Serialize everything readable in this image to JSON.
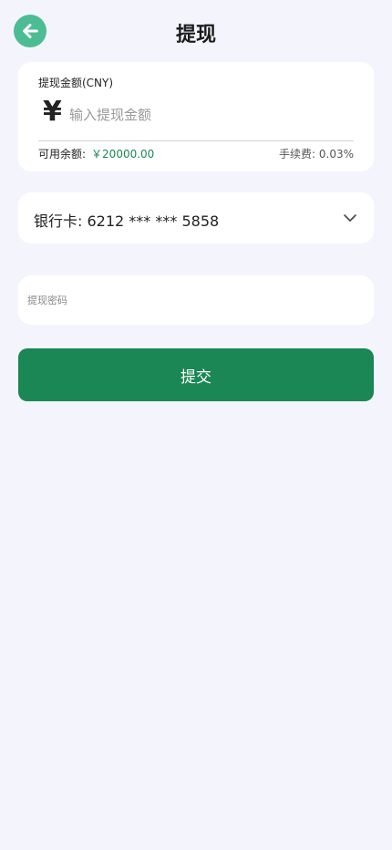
{
  "header": {
    "title": "提现",
    "back_icon": "arrow-left-icon"
  },
  "amount": {
    "label": "提现金额(CNY)",
    "currency_symbol": "¥",
    "placeholder": "输入提现金额",
    "value": "",
    "balance_label": "可用余额:",
    "balance_value": "￥20000.00",
    "fee_text": "手续费: 0.03%"
  },
  "bank": {
    "selected": "银行卡: 6212 *** *** 5858",
    "chevron_icon": "chevron-down-icon"
  },
  "password": {
    "placeholder": "提现密码",
    "value": ""
  },
  "submit": {
    "label": "提交"
  },
  "colors": {
    "background": "#f4f5fc",
    "back_button": "#4cbc95",
    "primary": "#1a8754",
    "balance_text": "#1a8754"
  }
}
